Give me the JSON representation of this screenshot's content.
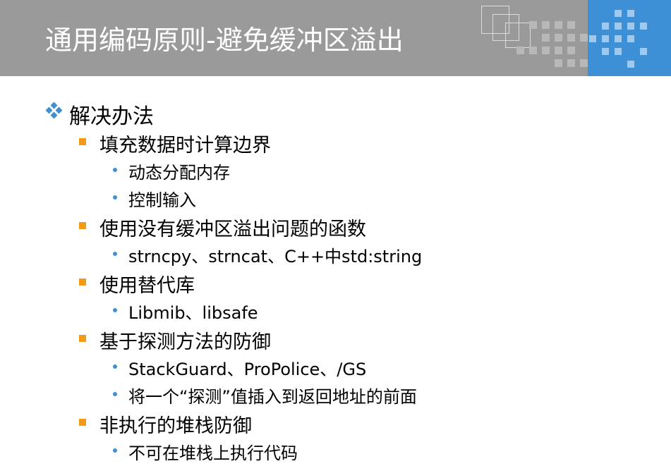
{
  "slide": {
    "title": "通用编码原则-避免缓冲区溢出",
    "heading": "解决办法",
    "sections": [
      {
        "label": "填充数据时计算边界",
        "items": [
          "动态分配内存",
          "控制输入"
        ]
      },
      {
        "label": "使用没有缓冲区溢出问题的函数",
        "items": [
          "strncpy、strncat、C++中std:string"
        ]
      },
      {
        "label": "使用替代库",
        "items": [
          "Libmib、libsafe"
        ]
      },
      {
        "label": "基于探测方法的防御",
        "items": [
          "StackGuard、ProPolice、/GS",
          "将一个“探测”值插入到返回地址的前面"
        ]
      },
      {
        "label": "非执行的堆栈防御",
        "items": [
          "不可在堆栈上执行代码"
        ]
      }
    ]
  },
  "colors": {
    "header": "#9a9a9a",
    "accent_blue": "#3d8fd6",
    "square_bullet": "#f39a1b",
    "diamond_bullet": "#3d8fd6"
  }
}
